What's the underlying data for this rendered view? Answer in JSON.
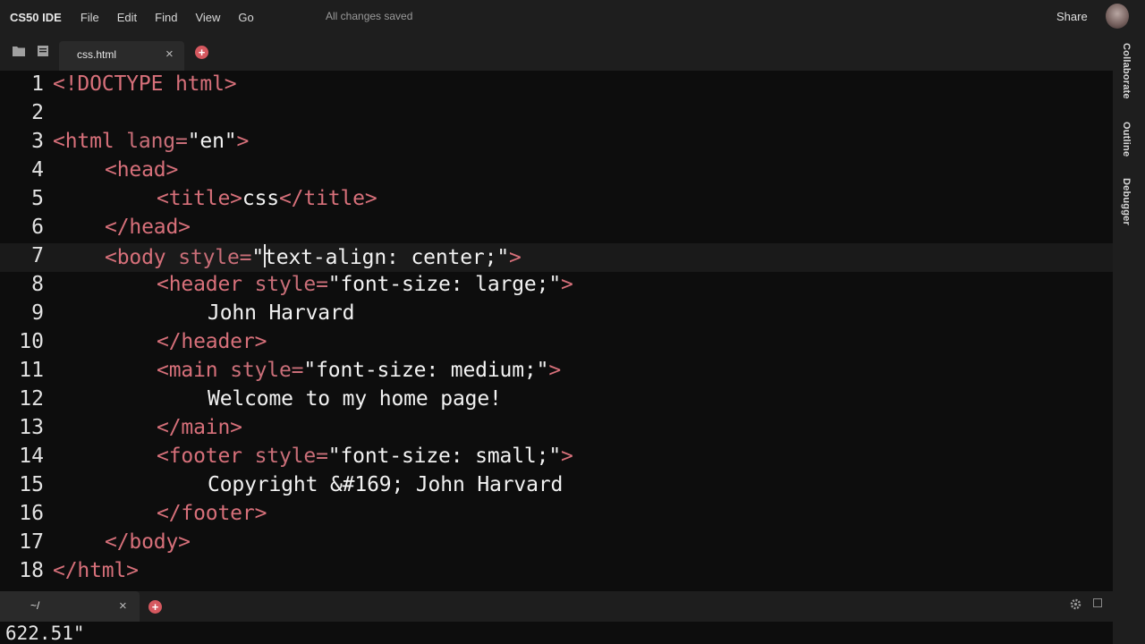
{
  "menubar": {
    "brand": "CS50 IDE",
    "items": [
      "File",
      "Edit",
      "Find",
      "View",
      "Go"
    ],
    "status": "All changes saved",
    "share": "Share"
  },
  "tabs": {
    "file_tab": "css.html",
    "close_glyph": "×",
    "add_glyph": "+"
  },
  "sidepanel": {
    "labels": [
      "Collaborate",
      "Outline",
      "Debugger"
    ]
  },
  "editor": {
    "active_line": 7,
    "lines": [
      {
        "n": "1"
      },
      {
        "n": "2"
      },
      {
        "n": "3"
      },
      {
        "n": "4"
      },
      {
        "n": "5"
      },
      {
        "n": "6"
      },
      {
        "n": "7"
      },
      {
        "n": "8"
      },
      {
        "n": "9"
      },
      {
        "n": "10"
      },
      {
        "n": "11"
      },
      {
        "n": "12"
      },
      {
        "n": "13"
      },
      {
        "n": "14"
      },
      {
        "n": "15"
      },
      {
        "n": "16"
      },
      {
        "n": "17"
      },
      {
        "n": "18"
      }
    ],
    "tokens": {
      "l1": "<!DOCTYPE html>",
      "l3_open": "<html ",
      "l3_attr": "lang=",
      "l3_val": "\"en\"",
      "l3_close": ">",
      "l4": "<head>",
      "l5_open": "<title>",
      "l5_text": "css",
      "l5_close": "</title>",
      "l6": "</head>",
      "l7_open": "<body ",
      "l7_attr": "style=",
      "l7_q": "\"",
      "l7_val": "text-align: center;\"",
      "l7_close": ">",
      "l8_open": "<header ",
      "l8_attr": "style=",
      "l8_val": "\"font-size: large;\"",
      "l8_close": ">",
      "l9": "John Harvard",
      "l10": "</header>",
      "l11_open": "<main ",
      "l11_attr": "style=",
      "l11_val": "\"font-size: medium;\"",
      "l11_close": ">",
      "l12": "Welcome to my home page!",
      "l13": "</main>",
      "l14_open": "<footer ",
      "l14_attr": "style=",
      "l14_val": "\"font-size: small;\"",
      "l14_close": ">",
      "l15": "Copyright &#169; John Harvard",
      "l16": "</footer>",
      "l17": "</body>",
      "l18": "</html>"
    }
  },
  "terminal": {
    "tab_label": "~/",
    "output": "622.51\""
  },
  "colors": {
    "tag": "#d7707a",
    "plus_button": "#d5585f",
    "editor_bg": "#0d0d0d"
  }
}
